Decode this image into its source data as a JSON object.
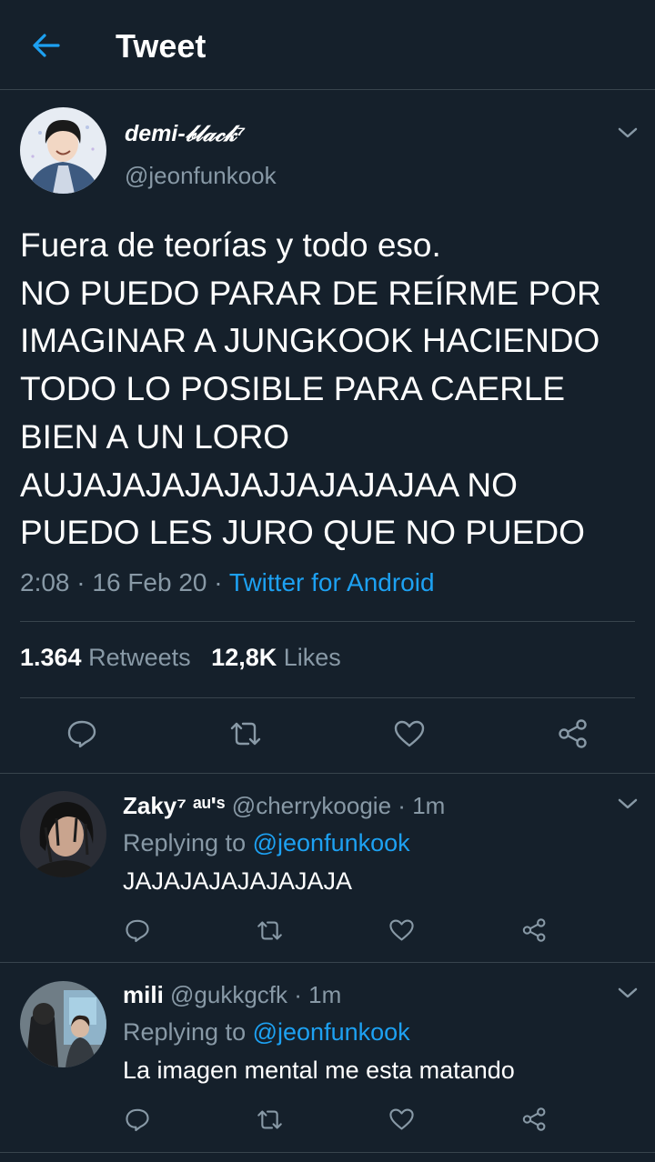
{
  "header": {
    "title": "Tweet",
    "back_icon": "arrow-left-icon"
  },
  "tweet": {
    "display_name": "demi-𝒷𝓁𝒶𝒸𝓀⁷",
    "handle": "@jeonfunkook",
    "text": "Fuera de teorías y todo eso.\nNO PUEDO PARAR DE REÍRME POR IMAGINAR A JUNGKOOK HACIENDO TODO LO POSIBLE PARA CAERLE BIEN A UN LORO AUJAJAJAJAJAJJAJAJAJAA NO PUEDO LES JURO QUE NO PUEDO",
    "time": "2:08",
    "date": "16 Feb 20",
    "separator": "·",
    "source": "Twitter for Android",
    "retweets_count": "1.364",
    "retweets_label": "Retweets",
    "likes_count": "12,8K",
    "likes_label": "Likes"
  },
  "replies": [
    {
      "name": "Zaky⁷ ᵃᵘ'ˢ",
      "handle": "@cherrykoogie",
      "separator": "·",
      "time": "1m",
      "replying_label": "Replying to",
      "replying_to": "@jeonfunkook",
      "text": "JAJAJAJAJAJAJAJA"
    },
    {
      "name": "mili",
      "handle": "@gukkgcfk",
      "separator": "·",
      "time": "1m",
      "replying_label": "Replying to",
      "replying_to": "@jeonfunkook",
      "text": "La imagen mental me esta matando"
    }
  ],
  "colors": {
    "background": "#15202b",
    "accent": "#1da1f2",
    "muted": "#8899a6",
    "divider": "#38444d"
  },
  "icons": [
    "arrow-left-icon",
    "chevron-down-icon",
    "reply-icon",
    "retweet-icon",
    "like-icon",
    "share-icon"
  ]
}
